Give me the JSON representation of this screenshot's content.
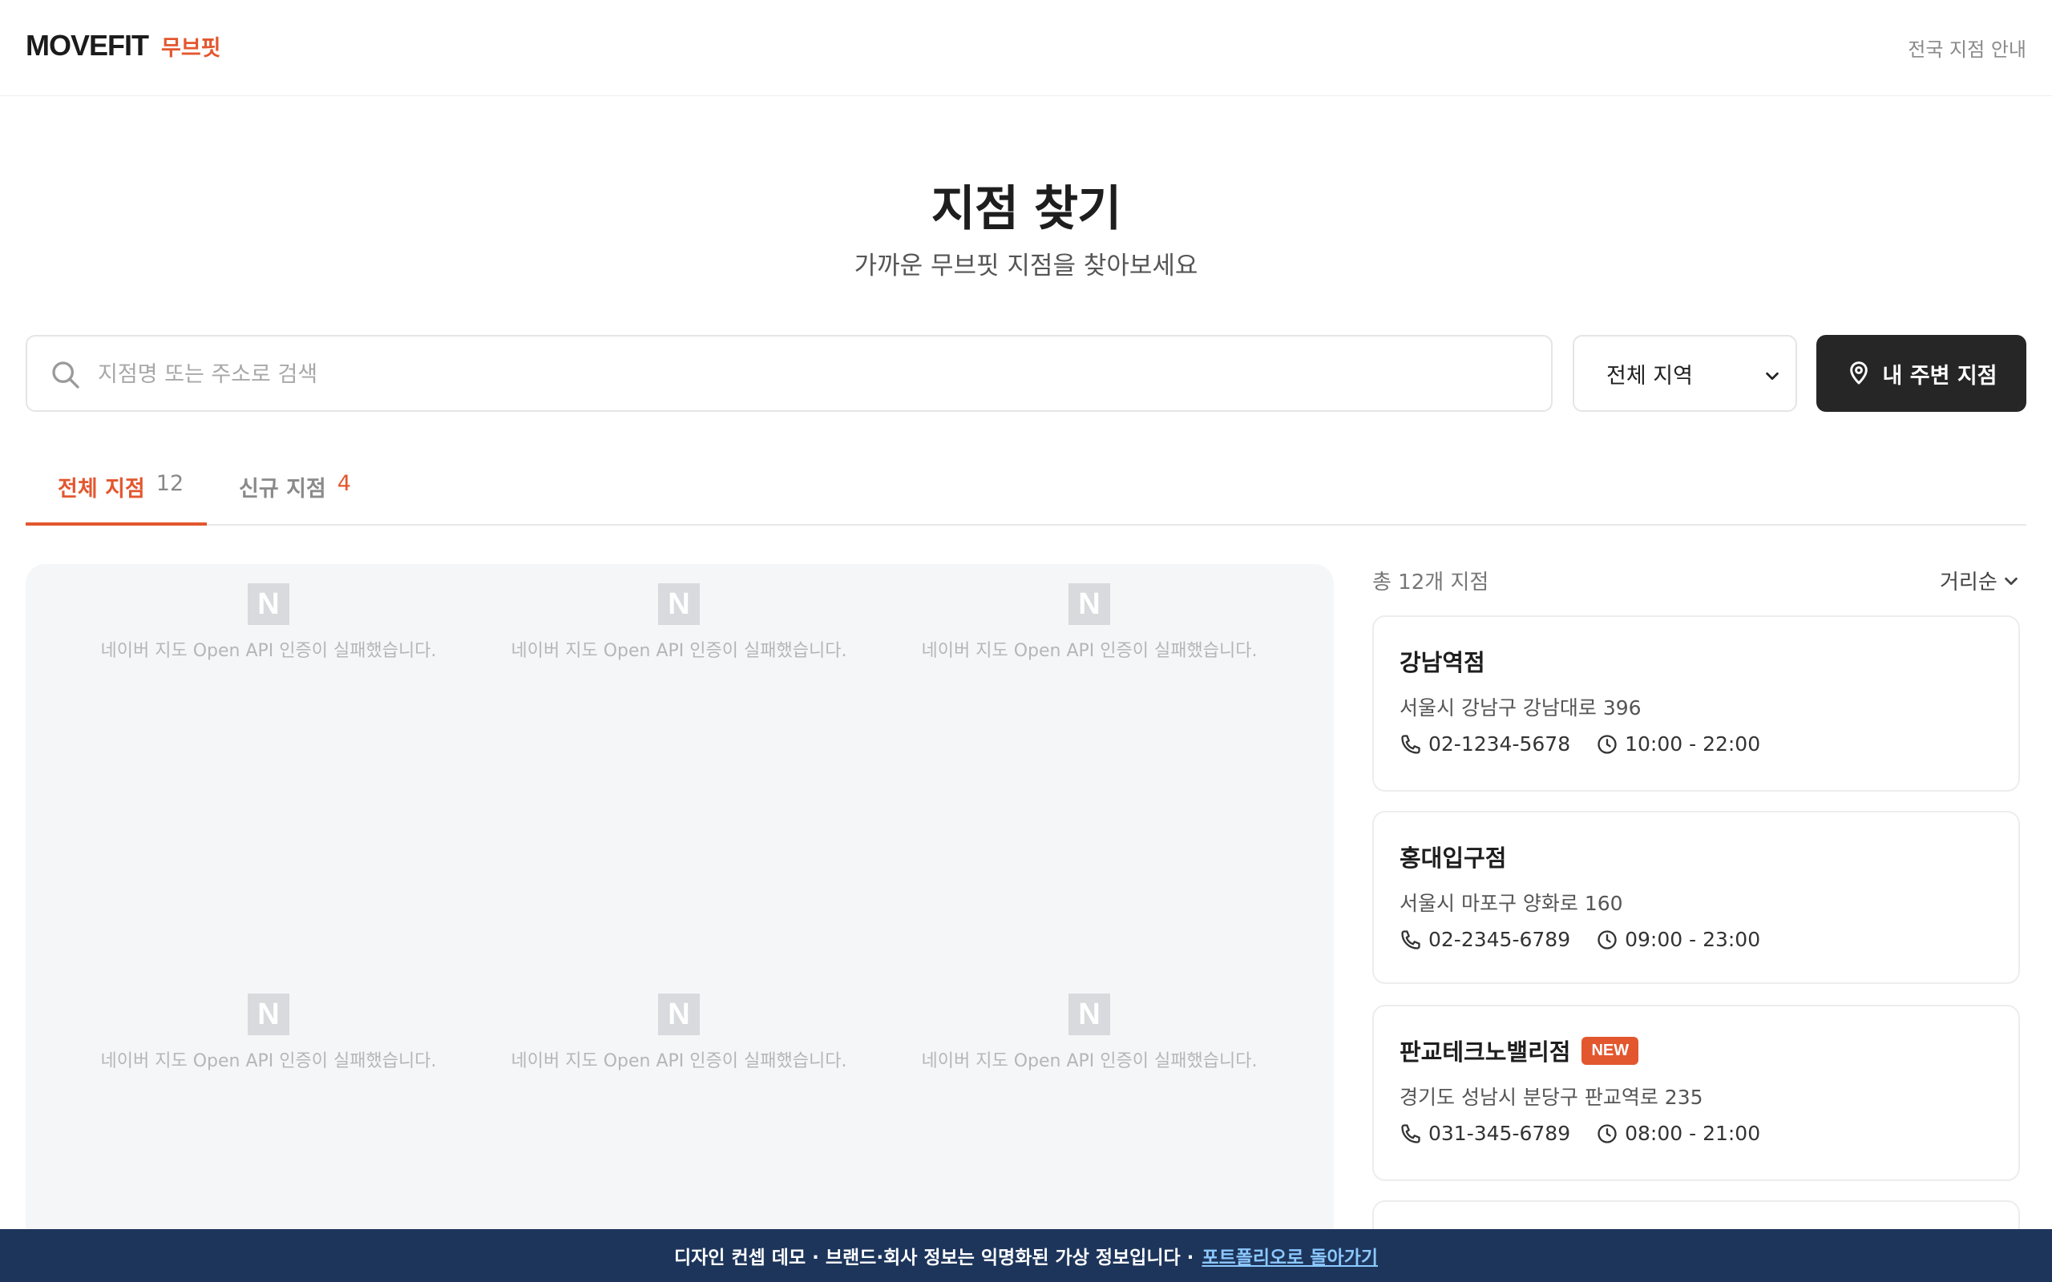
{
  "header": {
    "logo_en": "MOVEFIT",
    "logo_ko": "무브핏",
    "nav_link": "전국 지점 안내"
  },
  "hero": {
    "title": "지점 찾기",
    "subtitle": "가까운 무브핏 지점을 찾아보세요"
  },
  "search": {
    "placeholder": "지점명 또는 주소로 검색",
    "value": "",
    "icon": "search-icon"
  },
  "region": {
    "selected": "전체 지역",
    "icon": "chevron-down-icon"
  },
  "nearby_button": {
    "label": "내 주변 지점",
    "icon": "location-pin-icon"
  },
  "tabs": [
    {
      "label": "전체 지점",
      "count": "12",
      "active": true
    },
    {
      "label": "신규 지점",
      "count": "4",
      "active": false
    }
  ],
  "map": {
    "badge": "N",
    "error_message": "네이버 지도 Open API 인증이 실패했습니다."
  },
  "list": {
    "total": "총 12개 지점",
    "sort_label": "거리순"
  },
  "branches": [
    {
      "name": "강남역점",
      "address": "서울시 강남구 강남대로 396",
      "phone": "02-1234-5678",
      "hours": "10:00 - 22:00",
      "badge": ""
    },
    {
      "name": "홍대입구점",
      "address": "서울시 마포구 양화로 160",
      "phone": "02-2345-6789",
      "hours": "09:00 - 23:00",
      "badge": ""
    },
    {
      "name": "판교테크노밸리점",
      "address": "경기도 성남시 분당구 판교역로 235",
      "phone": "031-345-6789",
      "hours": "08:00 - 21:00",
      "badge": "NEW"
    }
  ],
  "footer": {
    "notice": "디자인 컨셉 데모 · 브랜드·회사 정보는 익명화된 가상 정보입니다 ·",
    "link": "포트폴리오로 돌아가기"
  },
  "colors": {
    "accent": "#e3572f",
    "dark_button": "#262626",
    "footer_bg": "#1d355b",
    "footer_link": "#8cc8ff",
    "map_bg": "#f5f6f8"
  }
}
